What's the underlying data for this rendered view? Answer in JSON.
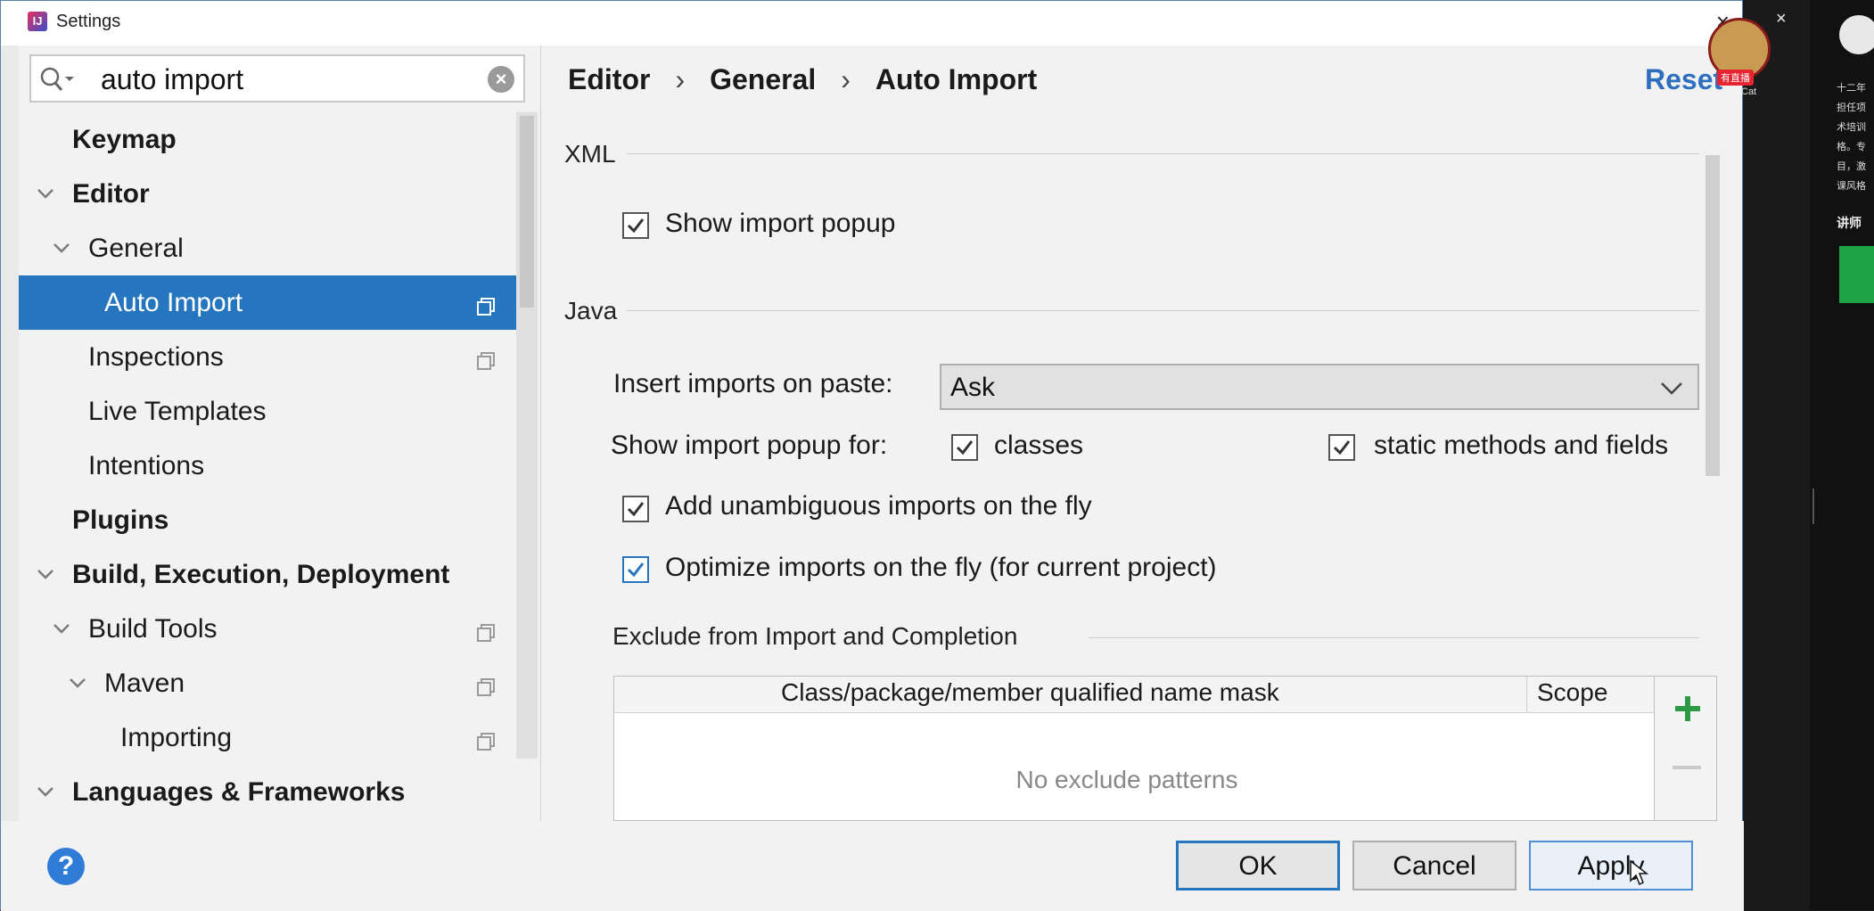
{
  "window": {
    "title": "Settings",
    "close_label": "×"
  },
  "search": {
    "value": "auto import",
    "clear_label": "×"
  },
  "tree": [
    {
      "label": "Keymap",
      "bold": true,
      "level": 0,
      "expandable": false
    },
    {
      "label": "Editor",
      "bold": true,
      "level": 0,
      "expandable": true
    },
    {
      "label": "General",
      "bold": false,
      "level": 1,
      "expandable": true
    },
    {
      "label": "Auto Import",
      "bold": false,
      "level": 2,
      "selected": true,
      "copy": true
    },
    {
      "label": "Inspections",
      "bold": false,
      "level": 1,
      "copy": true
    },
    {
      "label": "Live Templates",
      "bold": false,
      "level": 1
    },
    {
      "label": "Intentions",
      "bold": false,
      "level": 1
    },
    {
      "label": "Plugins",
      "bold": true,
      "level": 0
    },
    {
      "label": "Build, Execution, Deployment",
      "bold": true,
      "level": 0,
      "expandable": true
    },
    {
      "label": "Build Tools",
      "bold": false,
      "level": 1,
      "expandable": true,
      "copy": true
    },
    {
      "label": "Maven",
      "bold": false,
      "level": 2,
      "expandable": true,
      "copy": true
    },
    {
      "label": "Importing",
      "bold": false,
      "level": 3,
      "copy": true
    },
    {
      "label": "Languages & Frameworks",
      "bold": true,
      "level": 0,
      "expandable": true
    }
  ],
  "breadcrumb": {
    "items": [
      "Editor",
      "General",
      "Auto Import"
    ],
    "separator": "›"
  },
  "reset_label": "Reset",
  "xml": {
    "section": "XML",
    "show_import_popup": {
      "label": "Show import popup",
      "checked": true
    }
  },
  "java": {
    "section": "Java",
    "insert_imports": {
      "label": "Insert imports on paste:",
      "value": "Ask"
    },
    "show_popup_for": {
      "label": "Show import popup for:",
      "classes": {
        "label": "classes",
        "checked": true
      },
      "static": {
        "label": "static methods and fields",
        "checked": true
      }
    },
    "add_unambiguous": {
      "label": "Add unambiguous imports on the fly",
      "checked": true
    },
    "optimize": {
      "label": "Optimize imports on the fly (for current project)",
      "checked": true
    }
  },
  "exclude": {
    "section": "Exclude from Import and Completion",
    "columns": [
      "Class/package/member qualified name mask",
      "Scope"
    ],
    "empty_text": "No exclude patterns"
  },
  "footer": {
    "help": "?",
    "ok": "OK",
    "cancel": "Cancel",
    "apply": "Apply"
  },
  "overlay": {
    "live_badge": "有直播",
    "live_name": "Cat",
    "side_lines": [
      "十二年",
      "担任项",
      "术培训",
      "格。专",
      "目，激",
      "课风格"
    ],
    "side_title": "讲师",
    "close": "×"
  },
  "colors": {
    "selection": "#2675bf",
    "link": "#2f6fbf",
    "plus": "#2e9a45"
  }
}
